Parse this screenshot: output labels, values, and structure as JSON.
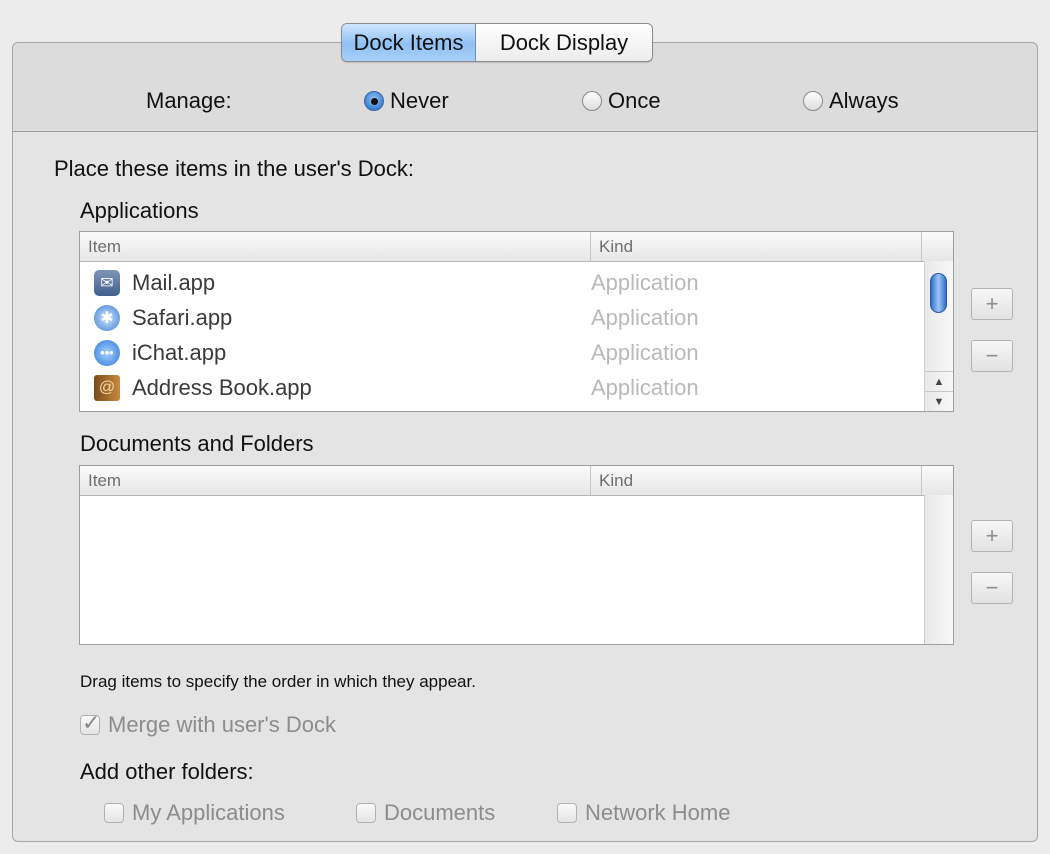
{
  "tabs": [
    {
      "label": "Dock Items"
    },
    {
      "label": "Dock Display"
    }
  ],
  "manage": {
    "label": "Manage:",
    "options": [
      {
        "label": "Never",
        "selected": true
      },
      {
        "label": "Once",
        "selected": false
      },
      {
        "label": "Always",
        "selected": false
      }
    ]
  },
  "place_heading": "Place these items in the user's Dock:",
  "applications": {
    "heading": "Applications",
    "columns": [
      "Item",
      "Kind"
    ],
    "rows": [
      {
        "name": "Mail.app",
        "kind": "Application",
        "icon": "mail-icon"
      },
      {
        "name": "Safari.app",
        "kind": "Application",
        "icon": "safari-icon"
      },
      {
        "name": "iChat.app",
        "kind": "Application",
        "icon": "ichat-icon"
      },
      {
        "name": "Address Book.app",
        "kind": "Application",
        "icon": "address-book-icon"
      }
    ]
  },
  "documents": {
    "heading": "Documents and Folders",
    "columns": [
      "Item",
      "Kind"
    ]
  },
  "buttons": {
    "add": "+",
    "remove": "−"
  },
  "drag_hint": "Drag items to specify the order in which they appear.",
  "merge": {
    "label": "Merge with user's Dock",
    "checked": true
  },
  "other_folders": {
    "heading": "Add other folders:",
    "options": [
      {
        "label": "My Applications",
        "checked": false
      },
      {
        "label": "Documents",
        "checked": false
      },
      {
        "label": "Network Home",
        "checked": false
      }
    ]
  }
}
